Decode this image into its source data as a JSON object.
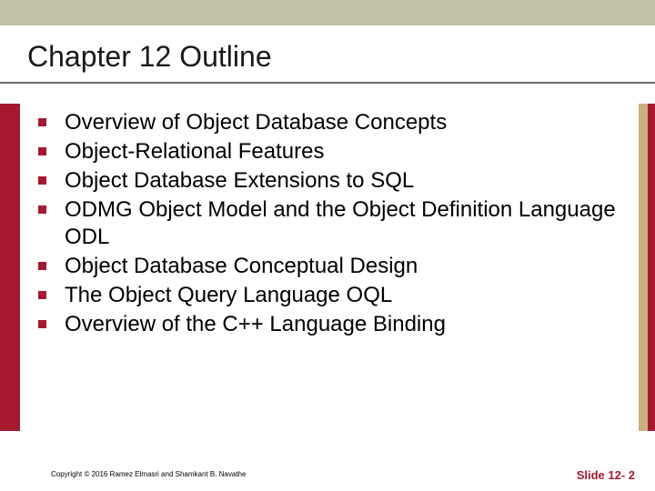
{
  "title": "Chapter 12 Outline",
  "bullets": [
    "Overview of Object Database Concepts",
    "Object-Relational Features",
    "Object Database Extensions to SQL",
    "ODMG Object Model and the Object Definition Language ODL",
    "Object Database Conceptual Design",
    "The Object Query Language OQL",
    "Overview of the C++ Language Binding"
  ],
  "copyright": "Copyright © 2016 Ramez Elmasri and Shamkant B. Navathe",
  "slide_number": "Slide 12- 2"
}
